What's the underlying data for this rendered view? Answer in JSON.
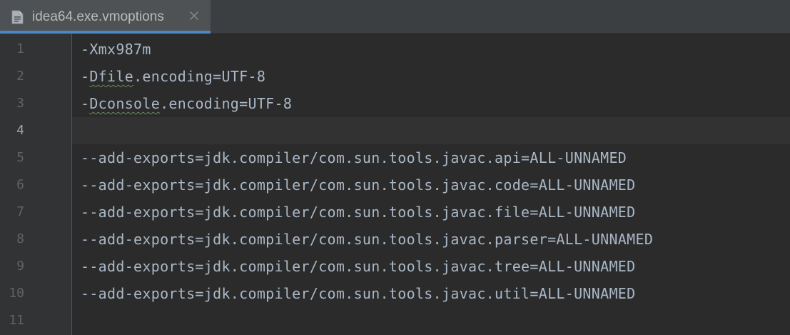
{
  "tab": {
    "title": "idea64.exe.vmoptions",
    "icon": "text-file-icon",
    "close_icon": "close-icon",
    "active_color": "#4a88c7"
  },
  "editor": {
    "current_line": 4,
    "lines": [
      {
        "number": "1",
        "prefix": "-",
        "typo": "",
        "suffix": "Xmx987m"
      },
      {
        "number": "2",
        "prefix": "-",
        "typo": "Dfile",
        "suffix": ".encoding=UTF-8"
      },
      {
        "number": "3",
        "prefix": "-",
        "typo": "Dconsole",
        "suffix": ".encoding=UTF-8"
      },
      {
        "number": "4",
        "prefix": "",
        "typo": "",
        "suffix": ""
      },
      {
        "number": "5",
        "prefix": "",
        "typo": "",
        "suffix": "--add-exports=jdk.compiler/com.sun.tools.javac.api=ALL-UNNAMED"
      },
      {
        "number": "6",
        "prefix": "",
        "typo": "",
        "suffix": "--add-exports=jdk.compiler/com.sun.tools.javac.code=ALL-UNNAMED"
      },
      {
        "number": "7",
        "prefix": "",
        "typo": "",
        "suffix": "--add-exports=jdk.compiler/com.sun.tools.javac.file=ALL-UNNAMED"
      },
      {
        "number": "8",
        "prefix": "",
        "typo": "",
        "suffix": "--add-exports=jdk.compiler/com.sun.tools.javac.parser=ALL-UNNAMED"
      },
      {
        "number": "9",
        "prefix": "",
        "typo": "",
        "suffix": "--add-exports=jdk.compiler/com.sun.tools.javac.tree=ALL-UNNAMED"
      },
      {
        "number": "10",
        "prefix": "",
        "typo": "",
        "suffix": "--add-exports=jdk.compiler/com.sun.tools.javac.util=ALL-UNNAMED"
      },
      {
        "number": "11",
        "prefix": "",
        "typo": "",
        "suffix": ""
      }
    ]
  }
}
